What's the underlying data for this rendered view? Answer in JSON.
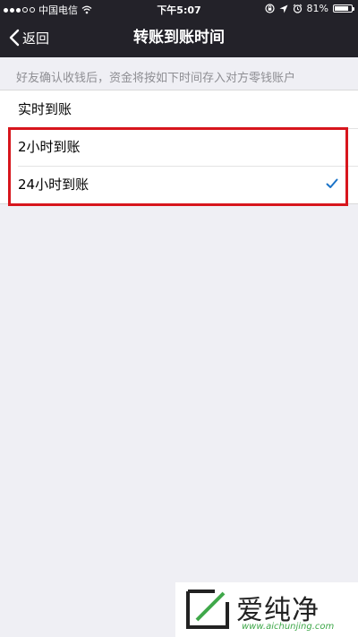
{
  "status_bar": {
    "carrier": "中国电信",
    "time": "下午5:07",
    "battery_percent": "81%",
    "battery_level": 0.81,
    "icons": [
      "signal-dots-icon",
      "wifi-icon",
      "lock-rotation-icon",
      "location-icon",
      "alarm-icon",
      "battery-icon"
    ]
  },
  "nav": {
    "back_label": "返回",
    "title": "转账到账时间"
  },
  "description": "好友确认收钱后，资金将按如下时间存入对方零钱账户",
  "options": [
    {
      "label": "实时到账",
      "selected": false
    },
    {
      "label": "2小时到账",
      "selected": false
    },
    {
      "label": "24小时到账",
      "selected": true
    }
  ],
  "colors": {
    "nav_background": "#232229",
    "page_background": "#efeff4",
    "check_color": "#1a73c8",
    "highlight_border": "#d7161d"
  },
  "watermark": {
    "text": "爱纯净",
    "url": "www.aichunjing.com"
  }
}
